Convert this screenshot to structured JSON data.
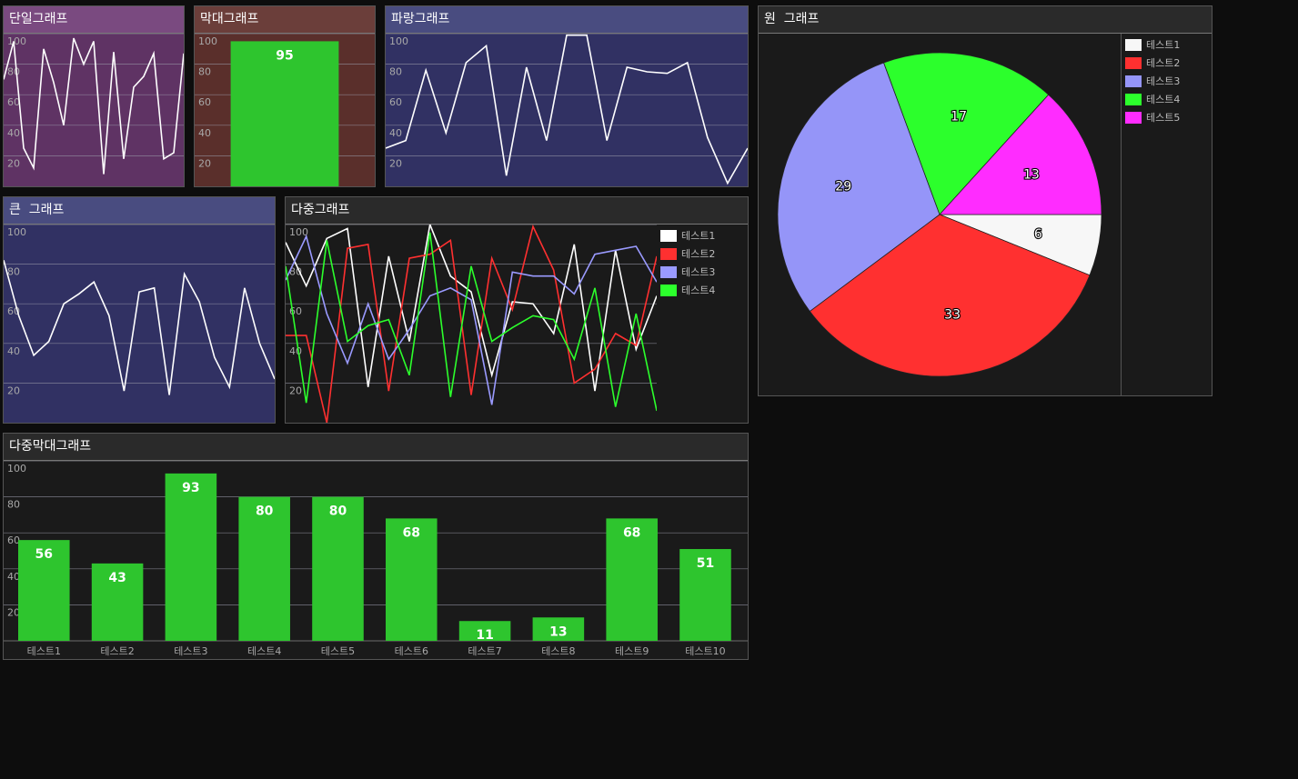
{
  "panels": {
    "single_line": {
      "title": "단일그래프",
      "header_color": "#7a4a80",
      "body_color": "#5f3364"
    },
    "single_bar": {
      "title": "막대그래프",
      "header_color": "#6b3e3a",
      "body_color": "#5a2f2b"
    },
    "blue_line": {
      "title": "파랑그래프",
      "header_color": "#494c80",
      "body_color": "#313163"
    },
    "big_line": {
      "title": "큰  그래프",
      "header_color": "#494c80",
      "body_color": "#313163"
    },
    "multi_line": {
      "title": "다중그래프",
      "header_color": "#2a2a2a",
      "body_color": "#1a1a1a"
    },
    "multi_bar": {
      "title": "다중막대그래프",
      "header_color": "#2a2a2a",
      "body_color": "#1a1a1a"
    },
    "pie": {
      "title": "원  그래프",
      "header_color": "#2a2a2a",
      "body_color": "#1a1a1a"
    }
  },
  "chart_data": [
    {
      "id": "single_line",
      "type": "line",
      "title": "단일그래프",
      "ylim": [
        0,
        100
      ],
      "yticks": [
        "20",
        "40",
        "60",
        "80",
        "100"
      ],
      "grid": true,
      "series": [
        {
          "color": "#ffffff",
          "values": [
            70,
            95,
            25,
            12,
            90,
            68,
            40,
            97,
            80,
            95,
            8,
            88,
            18,
            65,
            72,
            87,
            18,
            22,
            87
          ]
        }
      ]
    },
    {
      "id": "single_bar",
      "type": "bar",
      "title": "막대그래프",
      "ylim": [
        0,
        100
      ],
      "yticks": [
        "20",
        "40",
        "60",
        "80",
        "100"
      ],
      "grid": true,
      "values": [
        95
      ],
      "labels": [
        "95"
      ],
      "bar_color": "#2ec52e"
    },
    {
      "id": "blue_line",
      "type": "line",
      "title": "파랑그래프",
      "ylim": [
        0,
        100
      ],
      "yticks": [
        "20",
        "40",
        "60",
        "80",
        "100"
      ],
      "grid": true,
      "series": [
        {
          "color": "#ffffff",
          "values": [
            25,
            30,
            76,
            35,
            81,
            92,
            7,
            78,
            30,
            99,
            99,
            30,
            78,
            75,
            74,
            81,
            32,
            2,
            25
          ]
        }
      ]
    },
    {
      "id": "big_line",
      "type": "line",
      "title": "큰  그래프",
      "ylim": [
        0,
        100
      ],
      "yticks": [
        "20",
        "40",
        "60",
        "80",
        "100"
      ],
      "grid": true,
      "series": [
        {
          "color": "#ffffff",
          "values": [
            82,
            54,
            34,
            41,
            60,
            65,
            71,
            54,
            16,
            66,
            68,
            14,
            75,
            61,
            33,
            18,
            68,
            40,
            22
          ]
        }
      ]
    },
    {
      "id": "multi_line",
      "type": "line",
      "title": "다중그래프",
      "ylim": [
        0,
        100
      ],
      "yticks": [
        "20",
        "40",
        "60",
        "80",
        "100"
      ],
      "grid": true,
      "legend": "right",
      "series": [
        {
          "name": "테스트1",
          "color": "#ffffff",
          "values": [
            91,
            69,
            93,
            98,
            18,
            84,
            41,
            100,
            74,
            66,
            24,
            61,
            60,
            45,
            90,
            16,
            87,
            37,
            64
          ]
        },
        {
          "name": "테스트2",
          "color": "#ff3030",
          "values": [
            44,
            44,
            0,
            88,
            90,
            16,
            83,
            85,
            92,
            14,
            83,
            57,
            99,
            77,
            20,
            27,
            45,
            39,
            84
          ]
        },
        {
          "name": "테스트3",
          "color": "#9a9aff",
          "values": [
            72,
            94,
            55,
            30,
            60,
            32,
            47,
            64,
            68,
            62,
            9,
            76,
            74,
            74,
            65,
            85,
            87,
            89,
            71
          ]
        },
        {
          "name": "테스트4",
          "color": "#2cff2c",
          "values": [
            79,
            10,
            92,
            41,
            49,
            52,
            24,
            96,
            13,
            79,
            41,
            48,
            54,
            52,
            32,
            68,
            8,
            55,
            6
          ]
        }
      ]
    },
    {
      "id": "multi_bar",
      "type": "bar",
      "title": "다중막대그래프",
      "ylim": [
        0,
        100
      ],
      "yticks": [
        "20",
        "40",
        "60",
        "80",
        "100"
      ],
      "grid": true,
      "categories": [
        "테스트1",
        "테스트2",
        "테스트3",
        "테스트4",
        "테스트5",
        "테스트6",
        "테스트7",
        "테스트8",
        "테스트9",
        "테스트10"
      ],
      "values": [
        56,
        43,
        93,
        80,
        80,
        68,
        11,
        13,
        68,
        51
      ],
      "labels": [
        "56",
        "43",
        "93",
        "80",
        "80",
        "68",
        "11",
        "13",
        "68",
        "51"
      ],
      "bar_color": "#2ec52e"
    },
    {
      "id": "pie",
      "type": "pie",
      "title": "원  그래프",
      "legend": "right",
      "slices": [
        {
          "label": "테스트1",
          "value": 6,
          "text": "6",
          "color": "#f7f7f7"
        },
        {
          "label": "테스트2",
          "value": 33,
          "text": "33",
          "color": "#ff3030"
        },
        {
          "label": "테스트3",
          "value": 29,
          "text": "29",
          "color": "#9595f8"
        },
        {
          "label": "테스트4",
          "value": 17,
          "text": "17",
          "color": "#2cff2c"
        },
        {
          "label": "테스트5",
          "value": 13,
          "text": "13",
          "color": "#ff2cff"
        }
      ]
    }
  ]
}
